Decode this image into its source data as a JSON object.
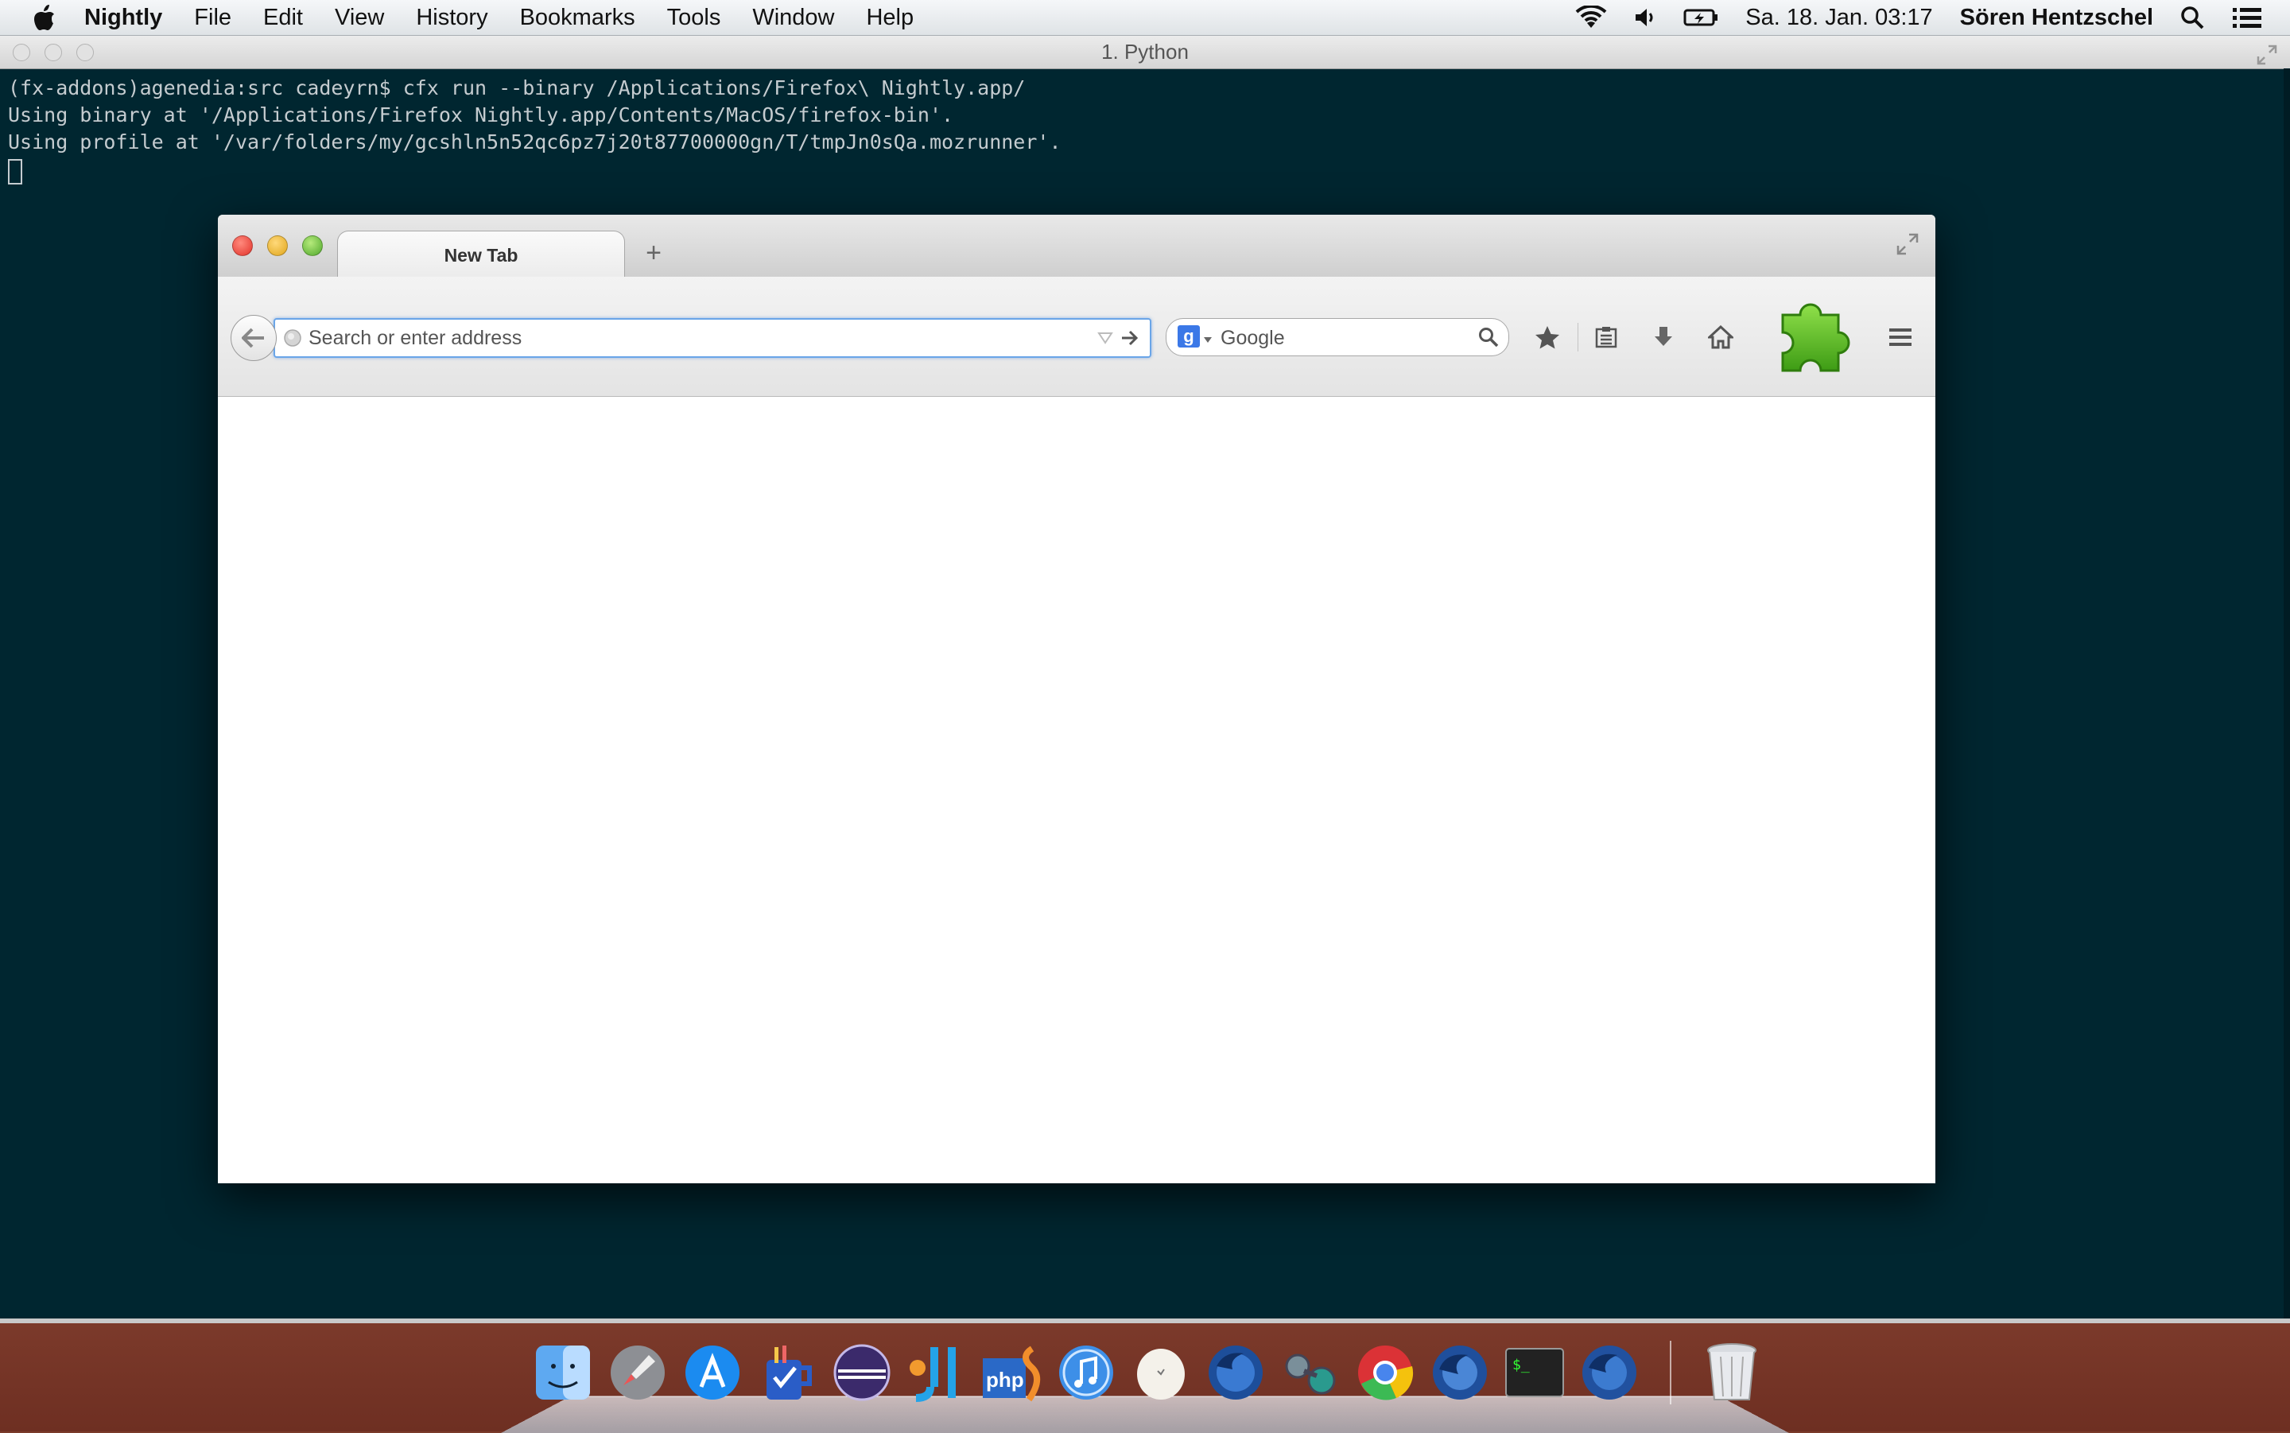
{
  "menubar": {
    "app_name": "Nightly",
    "items": [
      "File",
      "Edit",
      "View",
      "History",
      "Bookmarks",
      "Tools",
      "Window",
      "Help"
    ],
    "clock": "Sa. 18. Jan. 03:17",
    "user": "Sören Hentzschel"
  },
  "terminal": {
    "title": "1. Python",
    "lines": [
      "(fx-addons)agenedia:src cadeyrn$ cfx run --binary /Applications/Firefox\\ Nightly.app/",
      "Using binary at '/Applications/Firefox Nightly.app/Contents/MacOS/firefox-bin'.",
      "Using profile at '/var/folders/my/gcshln5n52qc6pz7j20t87700000gn/T/tmpJn0sQa.mozrunner'."
    ]
  },
  "firefox": {
    "tab_title": "New Tab",
    "url_placeholder": "Search or enter address",
    "search_engine": "Google",
    "search_placeholder": "Google"
  },
  "colors": {
    "terminal_bg": "#002630",
    "puzzle_green": "#4fb81e",
    "url_focus": "#6aa5e8"
  },
  "dock": {
    "icons": [
      "finder-icon",
      "launchpad-icon",
      "app-store-icon",
      "things-icon",
      "eclipse-icon",
      "jetbrains-icon",
      "phpstorm-icon",
      "itunes-icon",
      "app-egg-icon",
      "firefox-nightly-icon",
      "app-binoculars-icon",
      "chrome-icon",
      "firefox-aurora-icon",
      "terminal-icon",
      "firefox-icon",
      "trash-icon"
    ]
  }
}
